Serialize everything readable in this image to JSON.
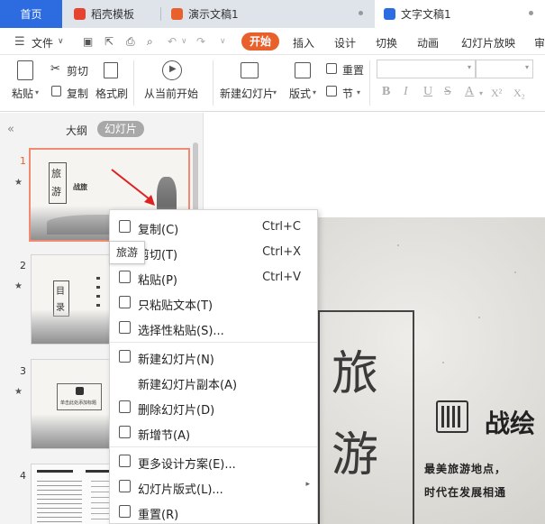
{
  "tabs": [
    {
      "label": "首页",
      "icon": "home"
    },
    {
      "label": "稻壳模板",
      "icon": "docer-icon",
      "color": "#e5452f"
    },
    {
      "label": "演示文稿1",
      "icon": "presentation-icon",
      "color": "#e8612c"
    },
    {
      "label": "文字文稿1",
      "icon": "writer-icon",
      "color": "#2c6ce0"
    }
  ],
  "menubar": {
    "file": "文件",
    "items": [
      "开始",
      "插入",
      "设计",
      "切换",
      "动画",
      "幻灯片放映",
      "审"
    ]
  },
  "ribbon": {
    "paste": "粘贴",
    "cut": "剪切",
    "copy": "复制",
    "format_painter": "格式刷",
    "from_current": "从当前开始",
    "new_slide": "新建幻灯片",
    "layout": "版式",
    "section": "节",
    "reset": "重置",
    "format_buttons": [
      "B",
      "I",
      "U",
      "S",
      "A",
      "X²",
      "X₂"
    ]
  },
  "panel": {
    "collapse": "«",
    "tab_outline": "大纲",
    "tab_slides": "幻灯片",
    "slide_numbers": [
      "1",
      "2",
      "3",
      "4"
    ]
  },
  "thumbs": {
    "s1_chars": [
      "旅",
      "游"
    ],
    "s1_word": "战旅",
    "s2_chars": [
      "目",
      "录"
    ],
    "s3_text": "单击此处添加标题"
  },
  "context_menu": [
    {
      "label": "复制(C)",
      "shortcut": "Ctrl+C",
      "icon": "copy-icon"
    },
    {
      "label": "剪切(T)",
      "shortcut": "Ctrl+X",
      "icon": "cut-icon"
    },
    {
      "label": "粘贴(P)",
      "shortcut": "Ctrl+V",
      "icon": "paste-icon"
    },
    {
      "label": "只粘贴文本(T)",
      "shortcut": "",
      "icon": "paste-text-icon"
    },
    {
      "label": "选择性粘贴(S)...",
      "shortcut": "",
      "icon": "paste-special-icon"
    },
    {
      "label": "新建幻灯片(N)",
      "shortcut": "",
      "icon": "new-slide-icon"
    },
    {
      "label": "新建幻灯片副本(A)",
      "shortcut": "",
      "icon": ""
    },
    {
      "label": "删除幻灯片(D)",
      "shortcut": "",
      "icon": "delete-slide-icon"
    },
    {
      "label": "新增节(A)",
      "shortcut": "",
      "icon": "add-section-icon"
    },
    {
      "label": "更多设计方案(E)...",
      "shortcut": "",
      "icon": "design-icon"
    },
    {
      "label": "幻灯片版式(L)...",
      "shortcut": "",
      "icon": "layout-icon"
    },
    {
      "label": "重置(R)",
      "shortcut": "",
      "icon": "reset-icon"
    }
  ],
  "tooltip": "旅游",
  "slide": {
    "char1": "旅",
    "char2": "游",
    "title": "战绘",
    "subtitle1": "最美旅游地点，",
    "subtitle2": "时代在发展相通"
  },
  "colors": {
    "accent": "#e8612c",
    "tab_home": "#2c6ce0",
    "selection_border": "#f08a70"
  }
}
